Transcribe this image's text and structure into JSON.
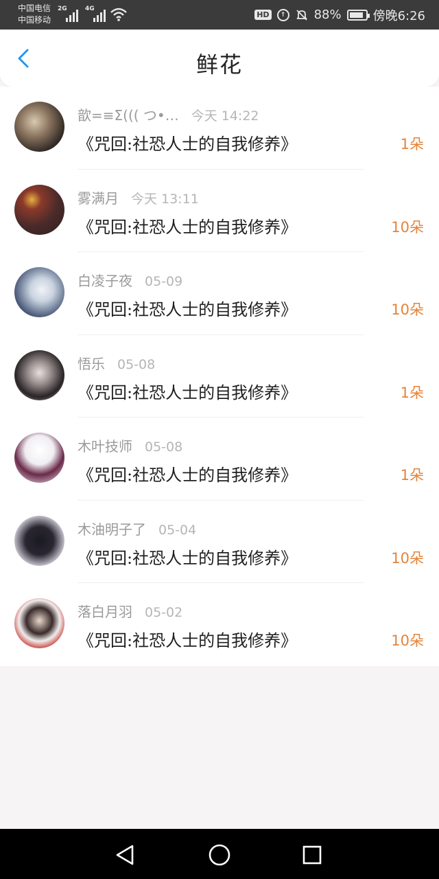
{
  "status_bar": {
    "carrier_1": "中国电信",
    "carrier_2": "中国移动",
    "net_1": "2G",
    "net_2": "4G",
    "hd": "HD",
    "battery_pct": "88%",
    "time": "傍晚6:26",
    "battery_level": 0.88
  },
  "header": {
    "title": "鲜花"
  },
  "items": [
    {
      "name": "歆=≡Σ((( つ•…",
      "time": "今天 14:22",
      "book": "《咒回:社恐人士的自我修养》",
      "count": "1朵"
    },
    {
      "name": "雾满月",
      "time": "今天 13:11",
      "book": "《咒回:社恐人士的自我修养》",
      "count": "10朵"
    },
    {
      "name": "白凌子夜",
      "time": "05-09",
      "book": "《咒回:社恐人士的自我修养》",
      "count": "10朵"
    },
    {
      "name": "悟乐",
      "time": "05-08",
      "book": "《咒回:社恐人士的自我修养》",
      "count": "1朵"
    },
    {
      "name": "木叶技师",
      "time": "05-08",
      "book": "《咒回:社恐人士的自我修养》",
      "count": "1朵"
    },
    {
      "name": "木油明子了",
      "time": "05-04",
      "book": "《咒回:社恐人士的自我修养》",
      "count": "10朵"
    },
    {
      "name": "落白月羽",
      "time": "05-02",
      "book": "《咒回:社恐人士的自我修养》",
      "count": "10朵"
    }
  ],
  "colors": {
    "accent_back": "#2196f3",
    "count": "#e5833a",
    "status_bg": "#3b3b3b",
    "nav_bg": "#000000"
  }
}
